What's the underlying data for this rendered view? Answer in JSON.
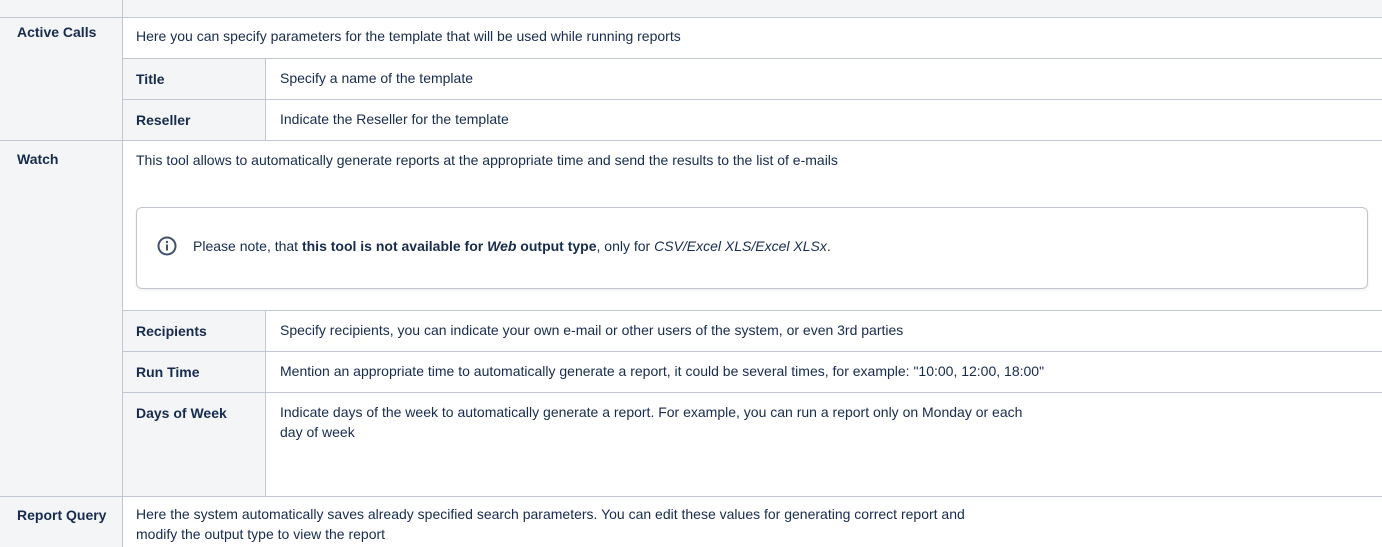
{
  "rows": [
    {
      "label": "Active Calls",
      "description": "Here you can specify parameters for the template that will be used while running reports",
      "params": [
        {
          "name": "Title",
          "text": "Specify a name of the template"
        },
        {
          "name": "Reseller",
          "text": "Indicate the Reseller for the template"
        }
      ]
    },
    {
      "label": "Watch",
      "description": "This tool allows to automatically generate reports at the appropriate time and send the results to the list of e-mails",
      "note": {
        "icon": "info-icon",
        "prefix": "Please note, that ",
        "bold1": "this tool is not available for ",
        "bold_italic": "Web",
        "bold2": " output type",
        "middle": ", only for ",
        "italic": "CSV/Excel XLS/Excel XLSx",
        "suffix": "."
      },
      "params": [
        {
          "name": "Recipients",
          "text": "Specify recipients, you can indicate your own e-mail or other users of the system, or even 3rd parties"
        },
        {
          "name": "Run Time",
          "text": "Mention an appropriate time to automatically generate a report, it could be several times, for example: \"10:00, 12:00, 18:00\""
        },
        {
          "name": "Days of Week",
          "text_line1": "Indicate days of the week to automatically generate a report. For example, you can run a report only on Monday or each",
          "text_line2": "day of week"
        }
      ]
    },
    {
      "label": "Report Query",
      "text_line1": "Here the system automatically saves already specified search parameters. You can edit these values for generating correct report and",
      "text_line2": "modify the output type to view the report"
    }
  ]
}
